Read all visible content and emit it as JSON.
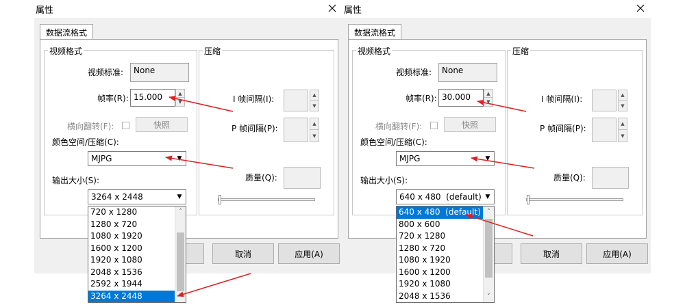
{
  "accent_color": "#0078d7",
  "annotation_color": "#e02020",
  "dialogs": [
    {
      "title": "属性",
      "close_icon": "close-icon",
      "tab": "数据流格式",
      "video_group_title": "视频格式",
      "video_standard_label": "视频标准:",
      "video_standard_value": "None",
      "frame_rate_label": "帧率(R):",
      "frame_rate_value": "15.000",
      "horizontal_flip_label": "横向翻转(F):",
      "snapshot_button": "快照",
      "color_space_label": "颜色空间/压缩(C):",
      "color_space_value": "MJPG",
      "output_size_label": "输出大小(S):",
      "output_size_value": "3264 x 2448",
      "compression_group_title": "压缩",
      "i_frame_label": "I 帧间隔(I):",
      "p_frame_label": "P 帧间隔(P):",
      "quality_label": "质量(Q):",
      "cancel_button": "取消",
      "apply_button": "应用(A)",
      "options": [
        "720 x 1280",
        "1280 x 720",
        "1080 x 1920",
        "1600 x 1200",
        "1920 x 1080",
        "2048 x 1536",
        "2592 x 1944",
        "3264 x 2448"
      ],
      "selected_index": 7
    },
    {
      "title": "属性",
      "close_icon": "close-icon",
      "tab": "数据流格式",
      "video_group_title": "视频格式",
      "video_standard_label": "视频标准:",
      "video_standard_value": "None",
      "frame_rate_label": "帧率(R):",
      "frame_rate_value": "30.000",
      "horizontal_flip_label": "横向翻转(F):",
      "snapshot_button": "快照",
      "color_space_label": "颜色空间/压缩(C):",
      "color_space_value": "MJPG",
      "output_size_label": "输出大小(S):",
      "output_size_value": "640 x 480  (default)",
      "compression_group_title": "压缩",
      "i_frame_label": "I 帧间隔(I):",
      "p_frame_label": "P 帧间隔(P):",
      "quality_label": "质量(Q):",
      "cancel_button": "取消",
      "apply_button": "应用(A)",
      "options": [
        "640 x 480  (default)",
        "800 x 600",
        "720 x 1280",
        "1280 x 720",
        "1080 x 1920",
        "1600 x 1200",
        "1920 x 1080",
        "2048 x 1536"
      ],
      "selected_index": 0
    }
  ]
}
